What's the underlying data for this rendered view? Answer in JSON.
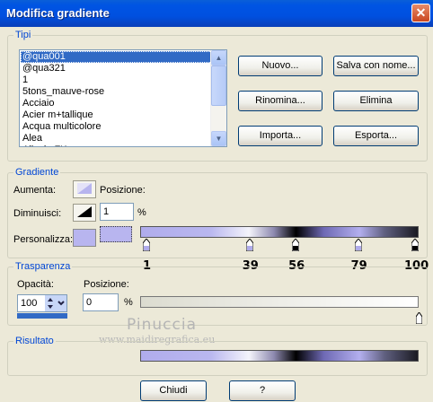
{
  "window": {
    "title": "Modifica gradiente",
    "close_glyph": "✕"
  },
  "tipi": {
    "legend": "Tipi",
    "list": [
      "@qua001",
      "@qua321",
      "1",
      "5tons_mauve-rose",
      "Acciaio",
      "Acier m+tallique",
      "Acqua multicolore",
      "Alea",
      "Alluvia FK"
    ],
    "selected_index": 0,
    "buttons": {
      "new": "Nuovo...",
      "save_as": "Salva con nome...",
      "rename": "Rinomina...",
      "delete": "Elimina",
      "import": "Importa...",
      "export": "Esporta..."
    }
  },
  "gradiente": {
    "legend": "Gradiente",
    "aumenta_label": "Aumenta:",
    "posizione_label": "Posizione:",
    "diminuisci_label": "Diminuisci:",
    "posizione_value": "1",
    "percent": "%",
    "personalizza_label": "Personalizza:",
    "stops": [
      {
        "label": "1",
        "pos": 1
      },
      {
        "label": "39",
        "pos": 39
      },
      {
        "label": "56",
        "pos": 56
      },
      {
        "label": "79",
        "pos": 79
      },
      {
        "label": "100",
        "pos": 100
      }
    ]
  },
  "trasparenza": {
    "legend": "Trasparenza",
    "opacita_label": "Opacità:",
    "opacita_value": "100",
    "posizione_label": "Posizione:",
    "posizione_value": "0",
    "percent": "%"
  },
  "risultato": {
    "legend": "Risultato"
  },
  "watermark": {
    "name": "Pinuccia",
    "site": "www.maidiregrafica.eu"
  },
  "footer": {
    "close": "Chiudi",
    "help": "?"
  },
  "colors": {
    "title_bar": "#0054e3",
    "accent": "#316ac5",
    "gradient_primary": "#b0acec"
  }
}
